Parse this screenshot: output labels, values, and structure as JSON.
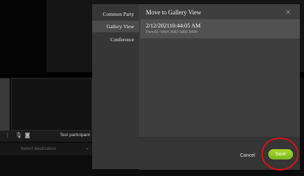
{
  "dialog": {
    "title": "Move to Gallery View",
    "close_icon": "close-icon",
    "sidebar": {
      "items": [
        {
          "label": "Common Party",
          "active": false
        },
        {
          "label": "Gallery View",
          "active": true
        },
        {
          "label": "Conference",
          "active": false
        }
      ]
    },
    "party": {
      "datetime": "2/12/202110:44:05 AM",
      "id": "PartyID: 5494 9583 5866 8408"
    },
    "footer": {
      "cancel_label": "Cancel",
      "save_label": "Save"
    }
  },
  "background": {
    "participant_label": "Test participant",
    "destination_placeholder": "Select destination",
    "icons": [
      "mic-icon",
      "camera-off-icon",
      "more-icon"
    ]
  },
  "colors": {
    "save_button": "#8cc726",
    "highlight_circle": "#e01010",
    "dialog_bg": "#3e3e3e",
    "sidebar_bg": "#363636"
  }
}
